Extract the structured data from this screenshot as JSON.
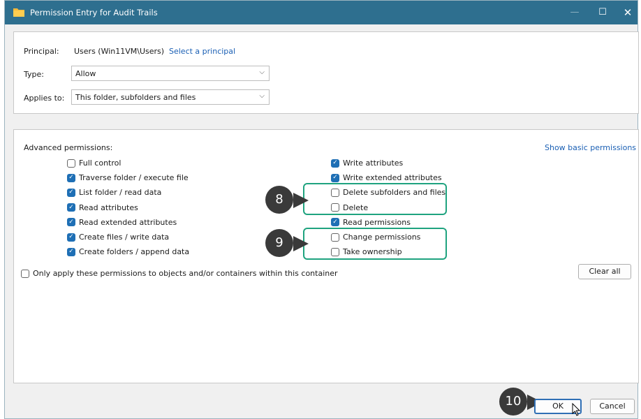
{
  "window": {
    "title": "Permission Entry for Audit Trails"
  },
  "titlebar": {
    "minimize": "—",
    "maximize": "☐",
    "close": "✕"
  },
  "principal": {
    "label": "Principal:",
    "value": "Users (Win11VM\\Users)",
    "link": "Select a principal"
  },
  "type": {
    "label": "Type:",
    "value": "Allow"
  },
  "applies_to": {
    "label": "Applies to:",
    "value": "This folder, subfolders and files"
  },
  "advanced": {
    "label": "Advanced permissions:",
    "show_basic_link": "Show basic permissions",
    "left": [
      {
        "label": "Full control",
        "checked": false
      },
      {
        "label": "Traverse folder / execute file",
        "checked": true
      },
      {
        "label": "List folder / read data",
        "checked": true
      },
      {
        "label": "Read attributes",
        "checked": true
      },
      {
        "label": "Read extended attributes",
        "checked": true
      },
      {
        "label": "Create files / write data",
        "checked": true
      },
      {
        "label": "Create folders / append data",
        "checked": true
      }
    ],
    "right": [
      {
        "label": "Write attributes",
        "checked": true
      },
      {
        "label": "Write extended attributes",
        "checked": true
      },
      {
        "label": "Delete subfolders and files",
        "checked": false
      },
      {
        "label": "Delete",
        "checked": false
      },
      {
        "label": "Read permissions",
        "checked": true
      },
      {
        "label": "Change permissions",
        "checked": false
      },
      {
        "label": "Take ownership",
        "checked": false
      }
    ],
    "only_apply": {
      "label": "Only apply these permissions to objects and/or containers within this container",
      "checked": false
    },
    "clear_all": "Clear all"
  },
  "callouts": {
    "c8": "8",
    "c9": "9",
    "c10": "10"
  },
  "buttons": {
    "ok": "OK",
    "cancel": "Cancel"
  }
}
